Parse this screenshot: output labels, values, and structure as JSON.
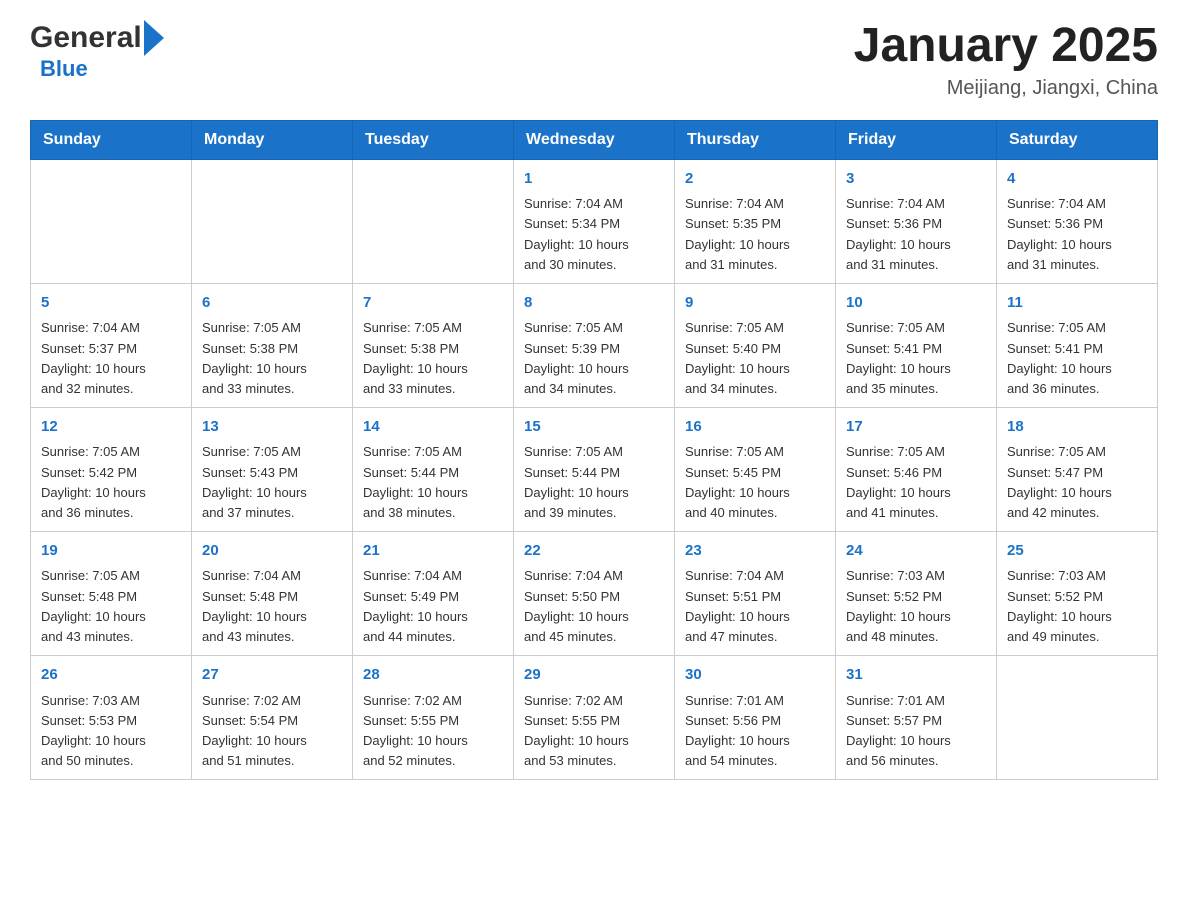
{
  "header": {
    "logo_general": "General",
    "logo_blue": "Blue",
    "title": "January 2025",
    "subtitle": "Meijiang, Jiangxi, China"
  },
  "days_of_week": [
    "Sunday",
    "Monday",
    "Tuesday",
    "Wednesday",
    "Thursday",
    "Friday",
    "Saturday"
  ],
  "weeks": [
    [
      {
        "num": "",
        "info": ""
      },
      {
        "num": "",
        "info": ""
      },
      {
        "num": "",
        "info": ""
      },
      {
        "num": "1",
        "info": "Sunrise: 7:04 AM\nSunset: 5:34 PM\nDaylight: 10 hours\nand 30 minutes."
      },
      {
        "num": "2",
        "info": "Sunrise: 7:04 AM\nSunset: 5:35 PM\nDaylight: 10 hours\nand 31 minutes."
      },
      {
        "num": "3",
        "info": "Sunrise: 7:04 AM\nSunset: 5:36 PM\nDaylight: 10 hours\nand 31 minutes."
      },
      {
        "num": "4",
        "info": "Sunrise: 7:04 AM\nSunset: 5:36 PM\nDaylight: 10 hours\nand 31 minutes."
      }
    ],
    [
      {
        "num": "5",
        "info": "Sunrise: 7:04 AM\nSunset: 5:37 PM\nDaylight: 10 hours\nand 32 minutes."
      },
      {
        "num": "6",
        "info": "Sunrise: 7:05 AM\nSunset: 5:38 PM\nDaylight: 10 hours\nand 33 minutes."
      },
      {
        "num": "7",
        "info": "Sunrise: 7:05 AM\nSunset: 5:38 PM\nDaylight: 10 hours\nand 33 minutes."
      },
      {
        "num": "8",
        "info": "Sunrise: 7:05 AM\nSunset: 5:39 PM\nDaylight: 10 hours\nand 34 minutes."
      },
      {
        "num": "9",
        "info": "Sunrise: 7:05 AM\nSunset: 5:40 PM\nDaylight: 10 hours\nand 34 minutes."
      },
      {
        "num": "10",
        "info": "Sunrise: 7:05 AM\nSunset: 5:41 PM\nDaylight: 10 hours\nand 35 minutes."
      },
      {
        "num": "11",
        "info": "Sunrise: 7:05 AM\nSunset: 5:41 PM\nDaylight: 10 hours\nand 36 minutes."
      }
    ],
    [
      {
        "num": "12",
        "info": "Sunrise: 7:05 AM\nSunset: 5:42 PM\nDaylight: 10 hours\nand 36 minutes."
      },
      {
        "num": "13",
        "info": "Sunrise: 7:05 AM\nSunset: 5:43 PM\nDaylight: 10 hours\nand 37 minutes."
      },
      {
        "num": "14",
        "info": "Sunrise: 7:05 AM\nSunset: 5:44 PM\nDaylight: 10 hours\nand 38 minutes."
      },
      {
        "num": "15",
        "info": "Sunrise: 7:05 AM\nSunset: 5:44 PM\nDaylight: 10 hours\nand 39 minutes."
      },
      {
        "num": "16",
        "info": "Sunrise: 7:05 AM\nSunset: 5:45 PM\nDaylight: 10 hours\nand 40 minutes."
      },
      {
        "num": "17",
        "info": "Sunrise: 7:05 AM\nSunset: 5:46 PM\nDaylight: 10 hours\nand 41 minutes."
      },
      {
        "num": "18",
        "info": "Sunrise: 7:05 AM\nSunset: 5:47 PM\nDaylight: 10 hours\nand 42 minutes."
      }
    ],
    [
      {
        "num": "19",
        "info": "Sunrise: 7:05 AM\nSunset: 5:48 PM\nDaylight: 10 hours\nand 43 minutes."
      },
      {
        "num": "20",
        "info": "Sunrise: 7:04 AM\nSunset: 5:48 PM\nDaylight: 10 hours\nand 43 minutes."
      },
      {
        "num": "21",
        "info": "Sunrise: 7:04 AM\nSunset: 5:49 PM\nDaylight: 10 hours\nand 44 minutes."
      },
      {
        "num": "22",
        "info": "Sunrise: 7:04 AM\nSunset: 5:50 PM\nDaylight: 10 hours\nand 45 minutes."
      },
      {
        "num": "23",
        "info": "Sunrise: 7:04 AM\nSunset: 5:51 PM\nDaylight: 10 hours\nand 47 minutes."
      },
      {
        "num": "24",
        "info": "Sunrise: 7:03 AM\nSunset: 5:52 PM\nDaylight: 10 hours\nand 48 minutes."
      },
      {
        "num": "25",
        "info": "Sunrise: 7:03 AM\nSunset: 5:52 PM\nDaylight: 10 hours\nand 49 minutes."
      }
    ],
    [
      {
        "num": "26",
        "info": "Sunrise: 7:03 AM\nSunset: 5:53 PM\nDaylight: 10 hours\nand 50 minutes."
      },
      {
        "num": "27",
        "info": "Sunrise: 7:02 AM\nSunset: 5:54 PM\nDaylight: 10 hours\nand 51 minutes."
      },
      {
        "num": "28",
        "info": "Sunrise: 7:02 AM\nSunset: 5:55 PM\nDaylight: 10 hours\nand 52 minutes."
      },
      {
        "num": "29",
        "info": "Sunrise: 7:02 AM\nSunset: 5:55 PM\nDaylight: 10 hours\nand 53 minutes."
      },
      {
        "num": "30",
        "info": "Sunrise: 7:01 AM\nSunset: 5:56 PM\nDaylight: 10 hours\nand 54 minutes."
      },
      {
        "num": "31",
        "info": "Sunrise: 7:01 AM\nSunset: 5:57 PM\nDaylight: 10 hours\nand 56 minutes."
      },
      {
        "num": "",
        "info": ""
      }
    ]
  ]
}
